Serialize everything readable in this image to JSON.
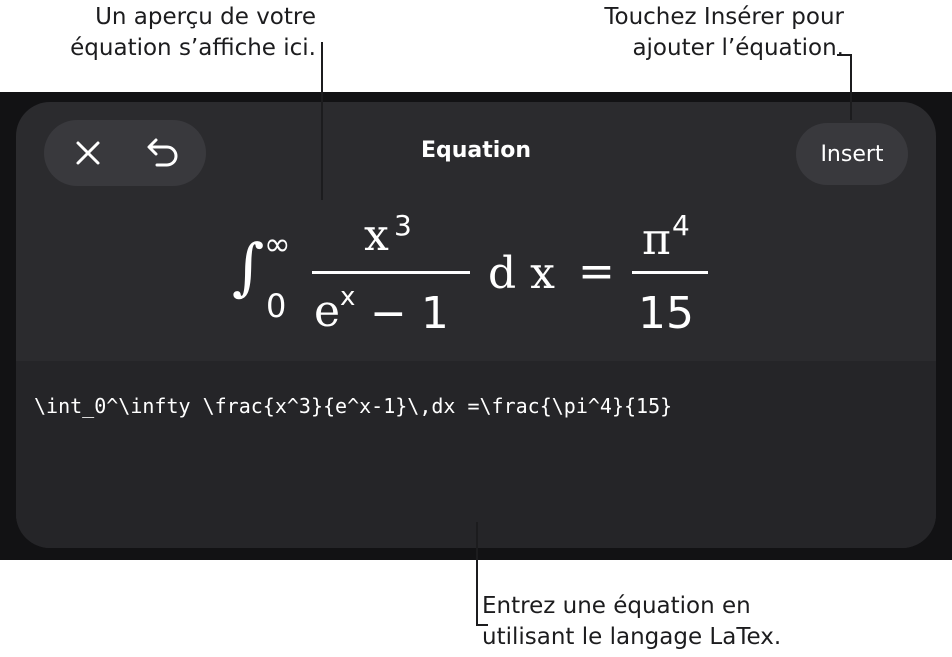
{
  "callouts": {
    "preview": [
      "Un aperçu de votre",
      "équation s’affiche ici."
    ],
    "insert": [
      "Touchez Insérer pour",
      "ajouter l’équation."
    ],
    "latex": [
      "Entrez une équation en",
      "utilisant le langage LaTex."
    ]
  },
  "toolbar": {
    "close_icon": "close-icon",
    "undo_icon": "undo-icon",
    "title": "Equation",
    "insert_label": "Insert"
  },
  "preview": {
    "integral_sign": "∫",
    "upper_limit": "∞",
    "lower_limit": "0",
    "numerator_base": "x",
    "numerator_exp": "3",
    "denominator_base": "e",
    "denominator_exp": "x",
    "denominator_rest": "− 1",
    "differential": "d x",
    "equals": "=",
    "rhs_numerator_base": "π",
    "rhs_numerator_exp": "4",
    "rhs_denominator": "15"
  },
  "editor": {
    "latex": "\\int_0^\\infty \\frac{x^3}{e^x-1}\\,dx =\\frac{\\pi^4}{15}"
  },
  "colors": {
    "panel": "#2b2b2e",
    "editor": "#252528",
    "button": "#39393d",
    "text": "#ffffff"
  }
}
